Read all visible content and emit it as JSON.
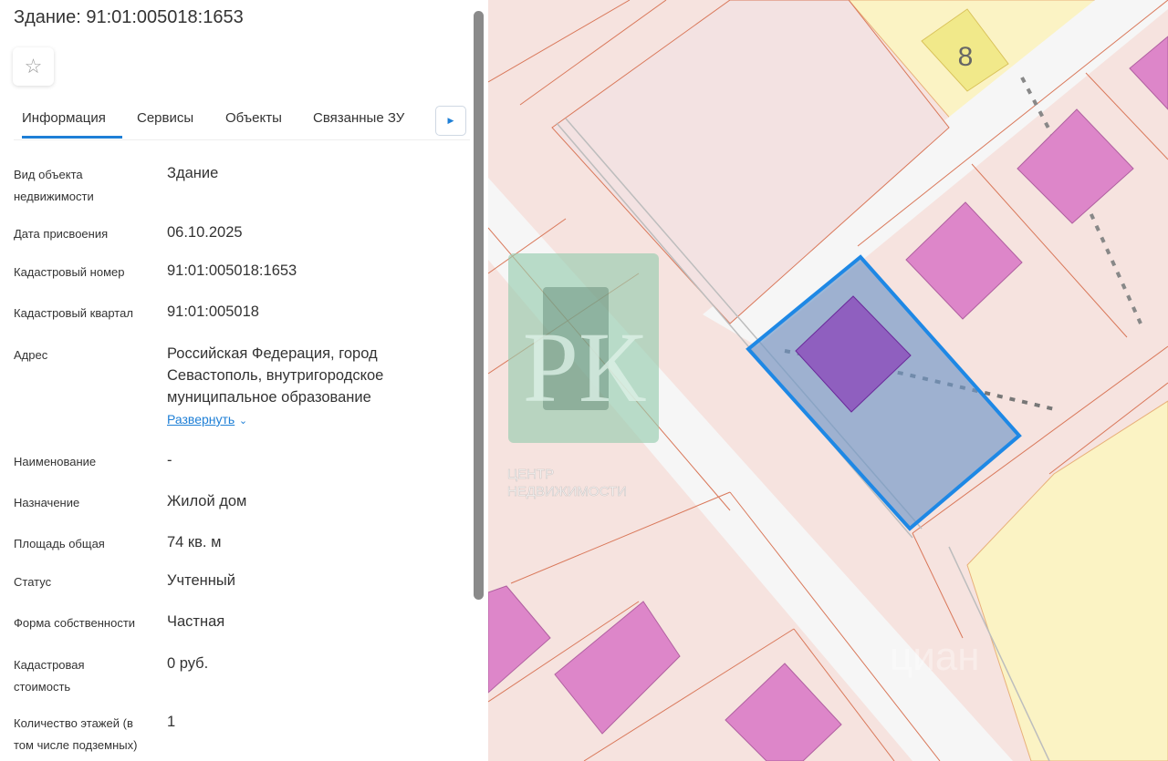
{
  "header": {
    "title": "Здание: 91:01:005018:1653",
    "favorite_icon": "star-icon"
  },
  "tabs": [
    {
      "label": "Информация",
      "active": true
    },
    {
      "label": "Сервисы"
    },
    {
      "label": "Объекты"
    },
    {
      "label": "Связанные ЗУ"
    }
  ],
  "tabs_next_icon": "chevron-right-icon",
  "fields": [
    {
      "label": "Вид объекта недвижимости",
      "value": "Здание"
    },
    {
      "label": "Дата присвоения",
      "value": "06.10.2025"
    },
    {
      "label": "Кадастровый номер",
      "value": "91:01:005018:1653"
    },
    {
      "label": "Кадастровый квартал",
      "value": "91:01:005018"
    },
    {
      "label": "Адрес",
      "value": "Российская Федерация, город Севастополь, внутригородское муниципальное образование",
      "expand": "Развернуть"
    },
    {
      "label": "Наименование",
      "value": "-"
    },
    {
      "label": "Назначение",
      "value": "Жилой дом"
    },
    {
      "label": "Площадь общая",
      "value": "74 кв. м"
    },
    {
      "label": "Статус",
      "value": "Учтенный"
    },
    {
      "label": "Форма собственности",
      "value": "Частная"
    },
    {
      "label": "Кадастровая стоимость",
      "value": "0 руб."
    },
    {
      "label": "Количество этажей (в том числе подземных)",
      "value": "1"
    }
  ],
  "map": {
    "parcel_label": "8",
    "watermark_logo": "РК",
    "watermark_text_1": "ЦЕНТР",
    "watermark_text_2": "НЕДВИЖИМОСТИ",
    "watermark_cian": "циан",
    "selected_color": "#1e88e5",
    "building_color": "#dd86c9"
  }
}
